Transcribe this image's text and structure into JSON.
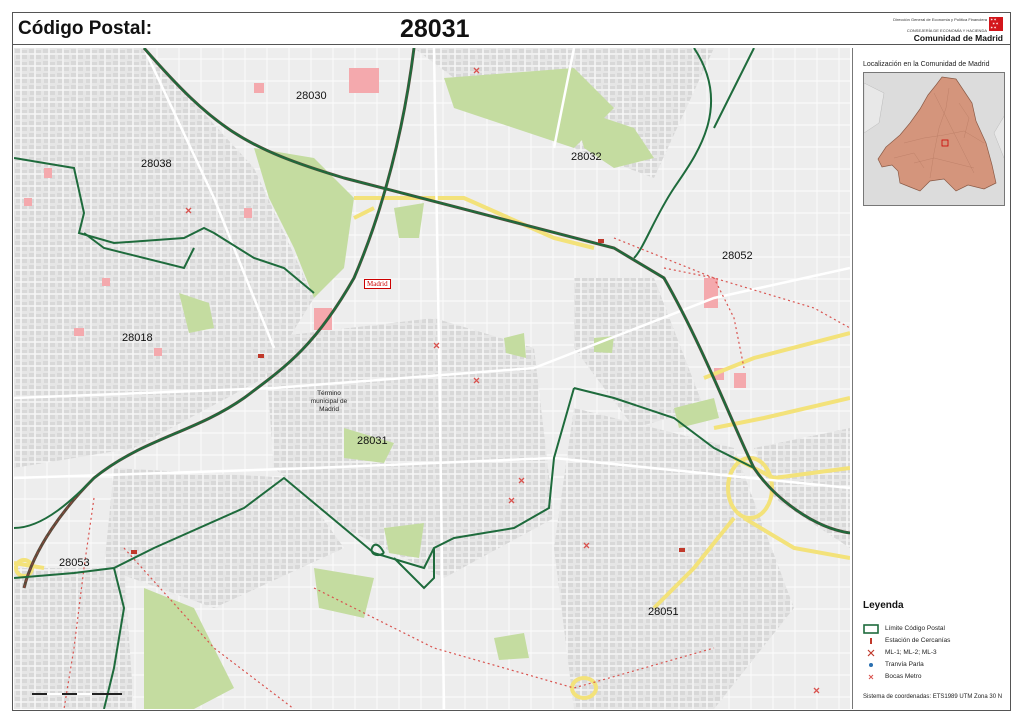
{
  "header": {
    "label": "Código Postal:",
    "code": "28031",
    "logo": {
      "line1": "Dirección General de Economía y Política Financiera",
      "line2": "CONSEJERÍA DE ECONOMÍA Y HACIENDA",
      "name": "Comunidad de Madrid"
    }
  },
  "map": {
    "zones": [
      "28030",
      "28038",
      "28032",
      "28052",
      "28018",
      "28031",
      "28053",
      "28051"
    ],
    "municipal_label": "Término municipal de Madrid",
    "city_label": "Madrid"
  },
  "sidebar": {
    "location_title": "Localización en la Comunidad de Madrid",
    "legend_title": "Leyenda",
    "legend": [
      {
        "label": "Límite Código Postal",
        "icon": "postal-boundary-swatch"
      },
      {
        "label": "Estación de Cercanías",
        "icon": "cercanias-icon"
      },
      {
        "label": "ML-1; ML-2; ML-3",
        "icon": "metro-ligero-icon"
      },
      {
        "label": "Tranvía Parla",
        "icon": "tranvia-icon"
      },
      {
        "label": "Bocas Metro",
        "icon": "metro-entrance-icon"
      }
    ],
    "coordinate_system": "Sistema de coordenadas: ETS1989 UTM Zona 30 N"
  },
  "colors": {
    "boundary": "#1e6b3c",
    "rail": "#5a4a3a",
    "highway": "#f3e27a",
    "park": "#c4dca0",
    "building": "#f4a9ad",
    "region": "#d4957c"
  }
}
